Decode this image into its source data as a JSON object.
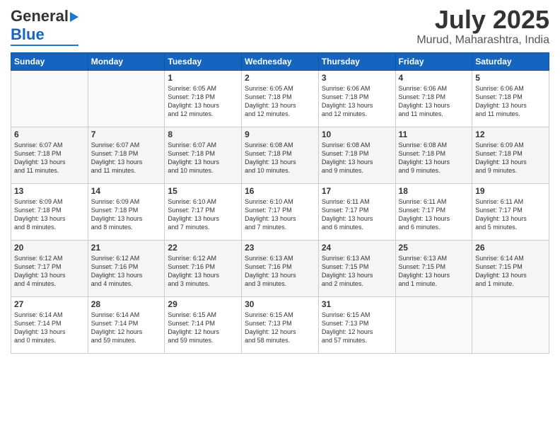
{
  "header": {
    "logo_line1": "General",
    "logo_line2": "Blue",
    "month": "July 2025",
    "location": "Murud, Maharashtra, India"
  },
  "days_of_week": [
    "Sunday",
    "Monday",
    "Tuesday",
    "Wednesday",
    "Thursday",
    "Friday",
    "Saturday"
  ],
  "weeks": [
    [
      {
        "day": "",
        "info": ""
      },
      {
        "day": "",
        "info": ""
      },
      {
        "day": "1",
        "info": "Sunrise: 6:05 AM\nSunset: 7:18 PM\nDaylight: 13 hours\nand 12 minutes."
      },
      {
        "day": "2",
        "info": "Sunrise: 6:05 AM\nSunset: 7:18 PM\nDaylight: 13 hours\nand 12 minutes."
      },
      {
        "day": "3",
        "info": "Sunrise: 6:06 AM\nSunset: 7:18 PM\nDaylight: 13 hours\nand 12 minutes."
      },
      {
        "day": "4",
        "info": "Sunrise: 6:06 AM\nSunset: 7:18 PM\nDaylight: 13 hours\nand 11 minutes."
      },
      {
        "day": "5",
        "info": "Sunrise: 6:06 AM\nSunset: 7:18 PM\nDaylight: 13 hours\nand 11 minutes."
      }
    ],
    [
      {
        "day": "6",
        "info": "Sunrise: 6:07 AM\nSunset: 7:18 PM\nDaylight: 13 hours\nand 11 minutes."
      },
      {
        "day": "7",
        "info": "Sunrise: 6:07 AM\nSunset: 7:18 PM\nDaylight: 13 hours\nand 11 minutes."
      },
      {
        "day": "8",
        "info": "Sunrise: 6:07 AM\nSunset: 7:18 PM\nDaylight: 13 hours\nand 10 minutes."
      },
      {
        "day": "9",
        "info": "Sunrise: 6:08 AM\nSunset: 7:18 PM\nDaylight: 13 hours\nand 10 minutes."
      },
      {
        "day": "10",
        "info": "Sunrise: 6:08 AM\nSunset: 7:18 PM\nDaylight: 13 hours\nand 9 minutes."
      },
      {
        "day": "11",
        "info": "Sunrise: 6:08 AM\nSunset: 7:18 PM\nDaylight: 13 hours\nand 9 minutes."
      },
      {
        "day": "12",
        "info": "Sunrise: 6:09 AM\nSunset: 7:18 PM\nDaylight: 13 hours\nand 9 minutes."
      }
    ],
    [
      {
        "day": "13",
        "info": "Sunrise: 6:09 AM\nSunset: 7:18 PM\nDaylight: 13 hours\nand 8 minutes."
      },
      {
        "day": "14",
        "info": "Sunrise: 6:09 AM\nSunset: 7:18 PM\nDaylight: 13 hours\nand 8 minutes."
      },
      {
        "day": "15",
        "info": "Sunrise: 6:10 AM\nSunset: 7:17 PM\nDaylight: 13 hours\nand 7 minutes."
      },
      {
        "day": "16",
        "info": "Sunrise: 6:10 AM\nSunset: 7:17 PM\nDaylight: 13 hours\nand 7 minutes."
      },
      {
        "day": "17",
        "info": "Sunrise: 6:11 AM\nSunset: 7:17 PM\nDaylight: 13 hours\nand 6 minutes."
      },
      {
        "day": "18",
        "info": "Sunrise: 6:11 AM\nSunset: 7:17 PM\nDaylight: 13 hours\nand 6 minutes."
      },
      {
        "day": "19",
        "info": "Sunrise: 6:11 AM\nSunset: 7:17 PM\nDaylight: 13 hours\nand 5 minutes."
      }
    ],
    [
      {
        "day": "20",
        "info": "Sunrise: 6:12 AM\nSunset: 7:17 PM\nDaylight: 13 hours\nand 4 minutes."
      },
      {
        "day": "21",
        "info": "Sunrise: 6:12 AM\nSunset: 7:16 PM\nDaylight: 13 hours\nand 4 minutes."
      },
      {
        "day": "22",
        "info": "Sunrise: 6:12 AM\nSunset: 7:16 PM\nDaylight: 13 hours\nand 3 minutes."
      },
      {
        "day": "23",
        "info": "Sunrise: 6:13 AM\nSunset: 7:16 PM\nDaylight: 13 hours\nand 3 minutes."
      },
      {
        "day": "24",
        "info": "Sunrise: 6:13 AM\nSunset: 7:15 PM\nDaylight: 13 hours\nand 2 minutes."
      },
      {
        "day": "25",
        "info": "Sunrise: 6:13 AM\nSunset: 7:15 PM\nDaylight: 13 hours\nand 1 minute."
      },
      {
        "day": "26",
        "info": "Sunrise: 6:14 AM\nSunset: 7:15 PM\nDaylight: 13 hours\nand 1 minute."
      }
    ],
    [
      {
        "day": "27",
        "info": "Sunrise: 6:14 AM\nSunset: 7:14 PM\nDaylight: 13 hours\nand 0 minutes."
      },
      {
        "day": "28",
        "info": "Sunrise: 6:14 AM\nSunset: 7:14 PM\nDaylight: 12 hours\nand 59 minutes."
      },
      {
        "day": "29",
        "info": "Sunrise: 6:15 AM\nSunset: 7:14 PM\nDaylight: 12 hours\nand 59 minutes."
      },
      {
        "day": "30",
        "info": "Sunrise: 6:15 AM\nSunset: 7:13 PM\nDaylight: 12 hours\nand 58 minutes."
      },
      {
        "day": "31",
        "info": "Sunrise: 6:15 AM\nSunset: 7:13 PM\nDaylight: 12 hours\nand 57 minutes."
      },
      {
        "day": "",
        "info": ""
      },
      {
        "day": "",
        "info": ""
      }
    ]
  ]
}
